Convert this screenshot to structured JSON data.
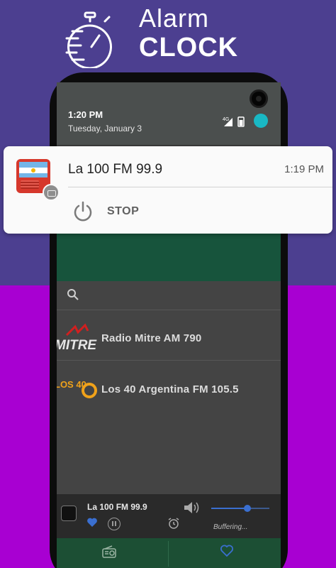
{
  "banner": {
    "title_line1": "Alarm",
    "title_line2": "CLOCK",
    "icon": "stopwatch-icon"
  },
  "status_bar": {
    "time": "1:20 PM",
    "date": "Tuesday, January 3",
    "network": "4G"
  },
  "notification": {
    "app_icon": "argentina-radio-icon",
    "title": "La 100 FM 99.9",
    "time": "1:19 PM",
    "action_label": "STOP",
    "action_icon": "power-icon"
  },
  "stations": [
    {
      "name": "Radio Mitre AM 790",
      "logo_text": "MITRE"
    },
    {
      "name": "Los 40 Argentina FM 105.5",
      "logo_text": "LOS 40"
    }
  ],
  "player": {
    "title": "La 100 FM 99.9",
    "status": "Buffering...",
    "volume": 0.62
  },
  "colors": {
    "banner_top": "#4c3f90",
    "banner_bottom": "#a800d2",
    "accent_blue": "#3a6fd0",
    "tab_green": "#1c4f34"
  }
}
